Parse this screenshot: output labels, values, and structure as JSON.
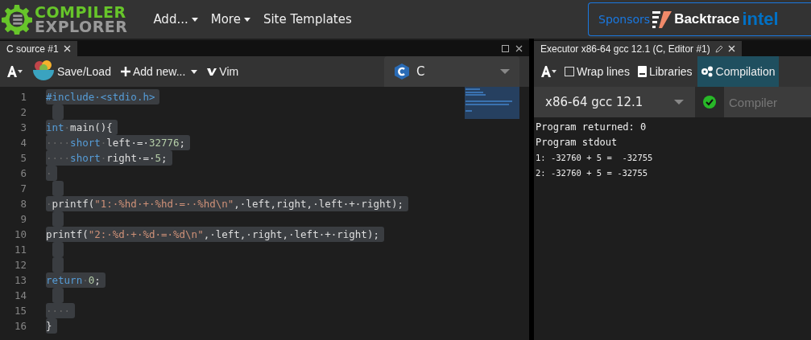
{
  "header": {
    "logo_top": "COMPILER",
    "logo_bottom": "EXPLORER",
    "menu": [
      {
        "label": "Add...",
        "dropdown": true
      },
      {
        "label": "More",
        "dropdown": true
      },
      {
        "label": "Site Templates",
        "dropdown": false
      }
    ],
    "sponsors": {
      "label": "Sponsors",
      "names": [
        "Backtrace",
        "intel"
      ]
    }
  },
  "editor": {
    "tab": "C source #1",
    "toolbar": {
      "save": "Save/Load",
      "add": "Add new...",
      "vim": "Vim"
    },
    "language": "C",
    "lines": [
      {
        "number": "1",
        "tokens": [
          {
            "kind": "kw",
            "text": "#include·<stdio.h>"
          }
        ]
      },
      {
        "number": "2"
      },
      {
        "number": "3",
        "tokens": [
          {
            "kind": "kw",
            "text": "int"
          },
          {
            "kind": "ws",
            "text": "·"
          },
          {
            "kind": "id",
            "text": "main(){"
          }
        ]
      },
      {
        "number": "4",
        "tokens": [
          {
            "kind": "ws",
            "text": "····"
          },
          {
            "kind": "kw",
            "text": "short"
          },
          {
            "kind": "ws",
            "text": "·"
          },
          {
            "kind": "id",
            "text": "left·=·"
          },
          {
            "kind": "num",
            "text": "32776"
          },
          {
            "kind": "id",
            "text": ";"
          }
        ]
      },
      {
        "number": "5",
        "tokens": [
          {
            "kind": "ws",
            "text": "····"
          },
          {
            "kind": "kw",
            "text": "short"
          },
          {
            "kind": "ws",
            "text": "·"
          },
          {
            "kind": "id",
            "text": "right·=·"
          },
          {
            "kind": "num",
            "text": "5"
          },
          {
            "kind": "id",
            "text": ";"
          }
        ]
      },
      {
        "number": "6",
        "tokens": [
          {
            "kind": "ws",
            "text": "·"
          }
        ]
      },
      {
        "number": "7"
      },
      {
        "number": "8",
        "tokens": [
          {
            "kind": "ws",
            "text": "·"
          },
          {
            "kind": "id",
            "text": "printf("
          },
          {
            "kind": "str",
            "text": "\"1:·%hd·+·%hd·=··%hd\\n\""
          },
          {
            "kind": "id",
            "text": ",·left,right,·left·+·right);"
          }
        ]
      },
      {
        "number": "9"
      },
      {
        "number": "10",
        "tokens": [
          {
            "kind": "id",
            "text": "printf("
          },
          {
            "kind": "str",
            "text": "\"2:·%d·+·%d·=·%d\\n\""
          },
          {
            "kind": "id",
            "text": ",·left,·right,·left·+·right);"
          }
        ]
      },
      {
        "number": "11"
      },
      {
        "number": "12"
      },
      {
        "number": "13",
        "tokens": [
          {
            "kind": "kw",
            "text": "return"
          },
          {
            "kind": "ws",
            "text": "·"
          },
          {
            "kind": "num",
            "text": "0"
          },
          {
            "kind": "id",
            "text": ";"
          }
        ]
      },
      {
        "number": "14"
      },
      {
        "number": "15",
        "tokens": [
          {
            "kind": "ws",
            "text": "····"
          }
        ]
      },
      {
        "number": "16",
        "tokens": [
          {
            "kind": "id",
            "text": "}"
          }
        ]
      }
    ]
  },
  "executor": {
    "tab": "Executor x86-64 gcc 12.1 (C, Editor #1)",
    "toolbar": [
      {
        "label": "Wrap lines",
        "kind": "checkbox",
        "checked": false,
        "selected": false
      },
      {
        "label": "Libraries",
        "kind": "book",
        "selected": false
      },
      {
        "label": "Compilation",
        "kind": "gears",
        "selected": true
      }
    ],
    "compiler": "x86-64 gcc 12.1",
    "compiler_options_placeholder": "Compiler",
    "output": [
      {
        "kind": "heading",
        "text": "Program returned: 0"
      },
      {
        "kind": "heading",
        "text": "Program stdout"
      },
      {
        "kind": "line",
        "text": "1: -32760 + 5 =  -32755"
      },
      {
        "kind": "line",
        "text": "2: -32760 + 5 = -32755"
      }
    ]
  }
}
